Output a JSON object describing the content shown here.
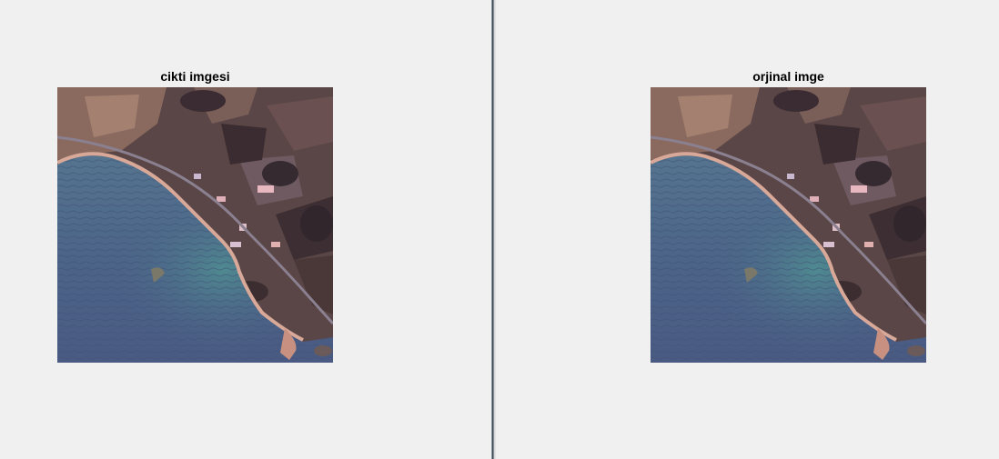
{
  "figure": {
    "left_axes": {
      "title": "cikti imgesi",
      "image_icon": "aerial-coastline-image"
    },
    "right_axes": {
      "title": "orjinal imge",
      "image_icon": "aerial-coastline-image"
    }
  },
  "colors": {
    "background": "#f0f0f0",
    "splitter": "#3a4a5a",
    "sea": "#4e6a8c",
    "land": "#4a3a3a",
    "beach": "#d6a89a"
  }
}
